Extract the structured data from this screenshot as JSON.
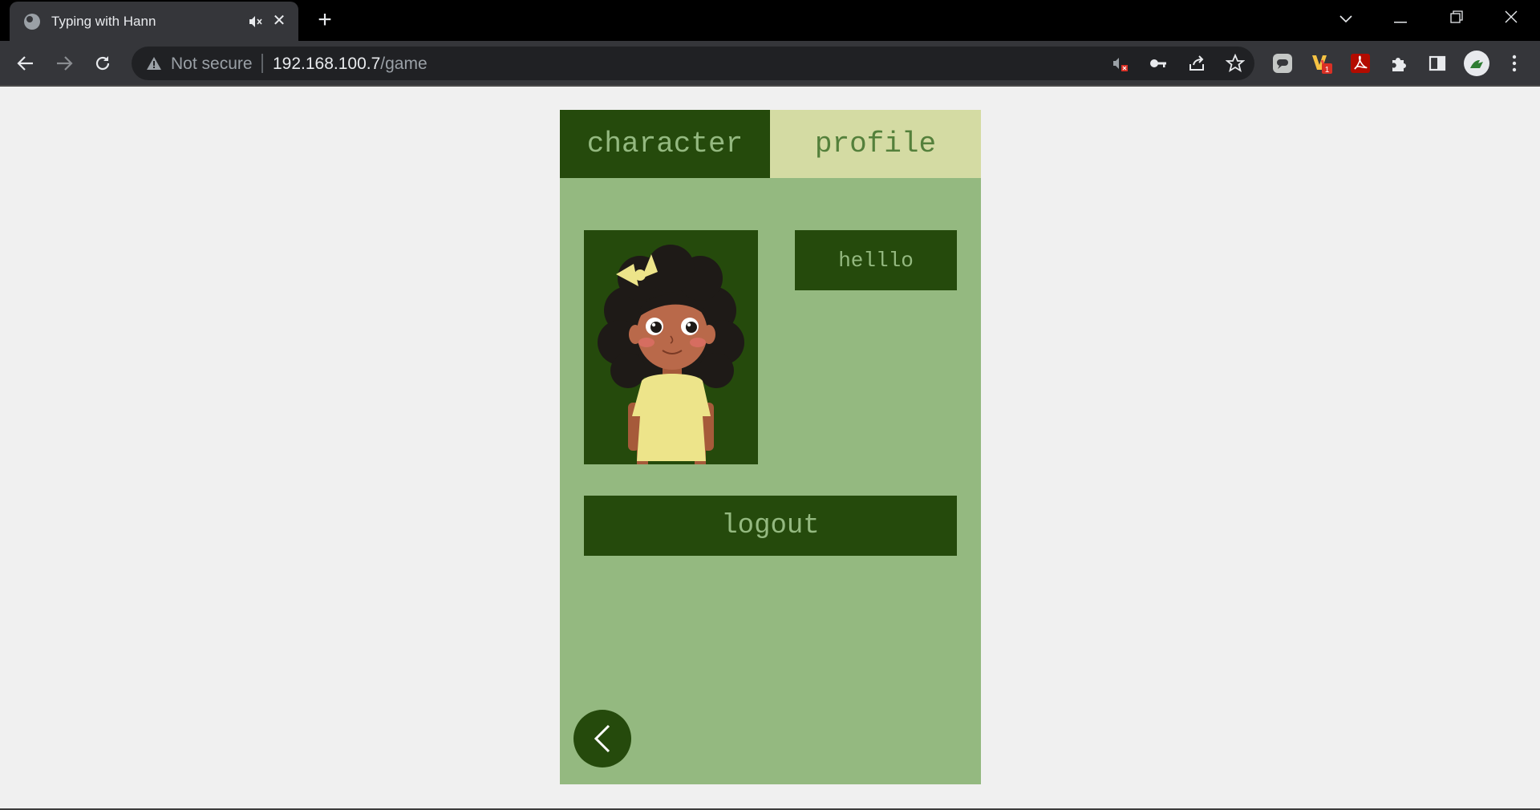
{
  "browser": {
    "tab_title": "Typing with Hann",
    "security_label": "Not secure",
    "url_host": "192.168.100.7",
    "url_path": "/game"
  },
  "game": {
    "tabs": [
      {
        "label": "character",
        "active": true
      },
      {
        "label": "profile",
        "active": false
      }
    ],
    "character_name": "helllo",
    "logout_label": "logout"
  },
  "colors": {
    "panel_bg": "#94b980",
    "dark_green": "#254a0c",
    "light_tab": "#d4dba3",
    "page_bg": "#f0f0f0"
  }
}
